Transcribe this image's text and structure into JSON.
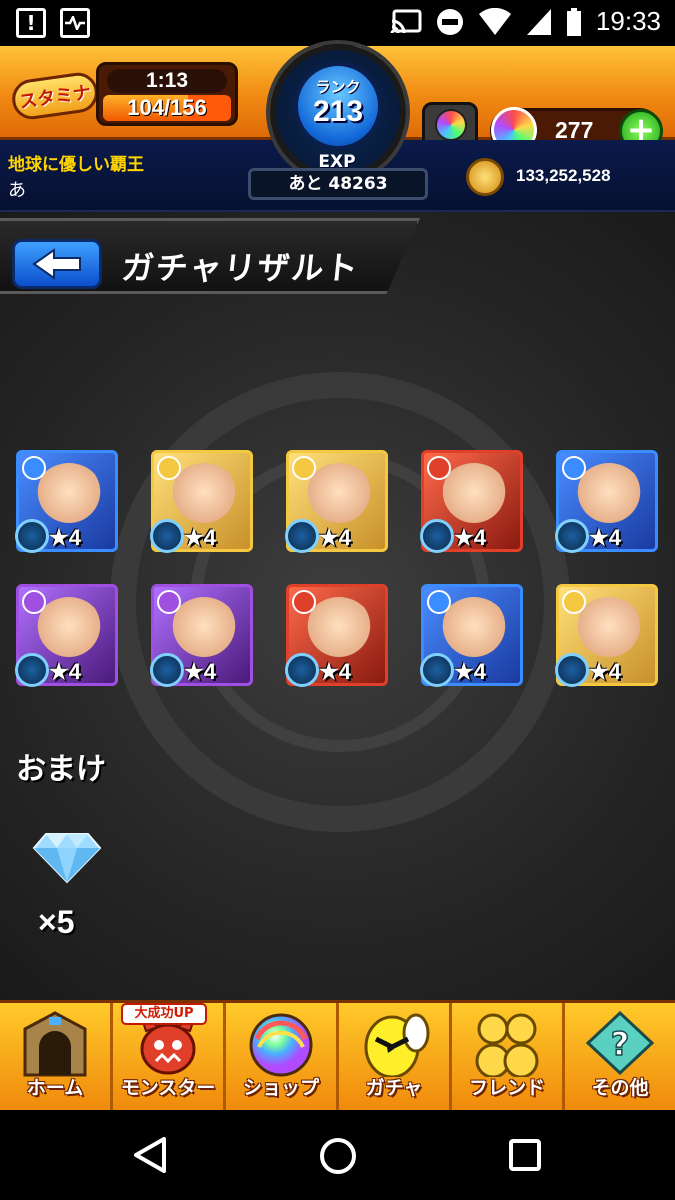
{
  "status_bar": {
    "time": "19:33",
    "left_icons": [
      "alert-icon",
      "activity-icon"
    ],
    "right_icons": [
      "cast-icon",
      "dnd-icon",
      "wifi-icon",
      "signal-icon",
      "battery-icon"
    ]
  },
  "header": {
    "stamina_label": "スタミナ",
    "stamina_timer": "1:13",
    "stamina_value": "104/156",
    "stamina_fraction": 0.667,
    "rank_label": "ランク",
    "rank_value": "213",
    "exp_label": "EXP",
    "exp_remaining": "あと 48263",
    "item_count": "---",
    "orb_count": "277",
    "player_title": "地球に優しい覇王",
    "player_name": "あ",
    "gold": "133,252,528"
  },
  "page": {
    "title": "ガチャリザルト"
  },
  "results": {
    "monsters": [
      {
        "star": "★4",
        "element": "water",
        "color": "#3a8cff"
      },
      {
        "star": "★4",
        "element": "light",
        "color": "#f4c840"
      },
      {
        "star": "★4",
        "element": "light",
        "color": "#f4c840"
      },
      {
        "star": "★4",
        "element": "fire",
        "color": "#e0402a"
      },
      {
        "star": "★4",
        "element": "water",
        "color": "#3a8cff"
      },
      {
        "star": "★4",
        "element": "dark",
        "color": "#a050e0"
      },
      {
        "star": "★4",
        "element": "dark",
        "color": "#a050e0"
      },
      {
        "star": "★4",
        "element": "fire",
        "color": "#e0402a"
      },
      {
        "star": "★4",
        "element": "water",
        "color": "#3a8cff"
      },
      {
        "star": "★4",
        "element": "light",
        "color": "#f4c840"
      }
    ]
  },
  "bonus": {
    "title": "おまけ",
    "item_icon": "diamond-icon",
    "quantity": "×5"
  },
  "nav": {
    "items": [
      {
        "label": "ホーム",
        "icon": "home-gate-icon"
      },
      {
        "label": "モンスター",
        "icon": "monster-icon",
        "badge": "大成功UP"
      },
      {
        "label": "ショップ",
        "icon": "rainbow-orb-icon"
      },
      {
        "label": "ガチャ",
        "icon": "gacha-egg-icon"
      },
      {
        "label": "フレンド",
        "icon": "friends-icon"
      },
      {
        "label": "その他",
        "icon": "other-icon"
      }
    ]
  }
}
